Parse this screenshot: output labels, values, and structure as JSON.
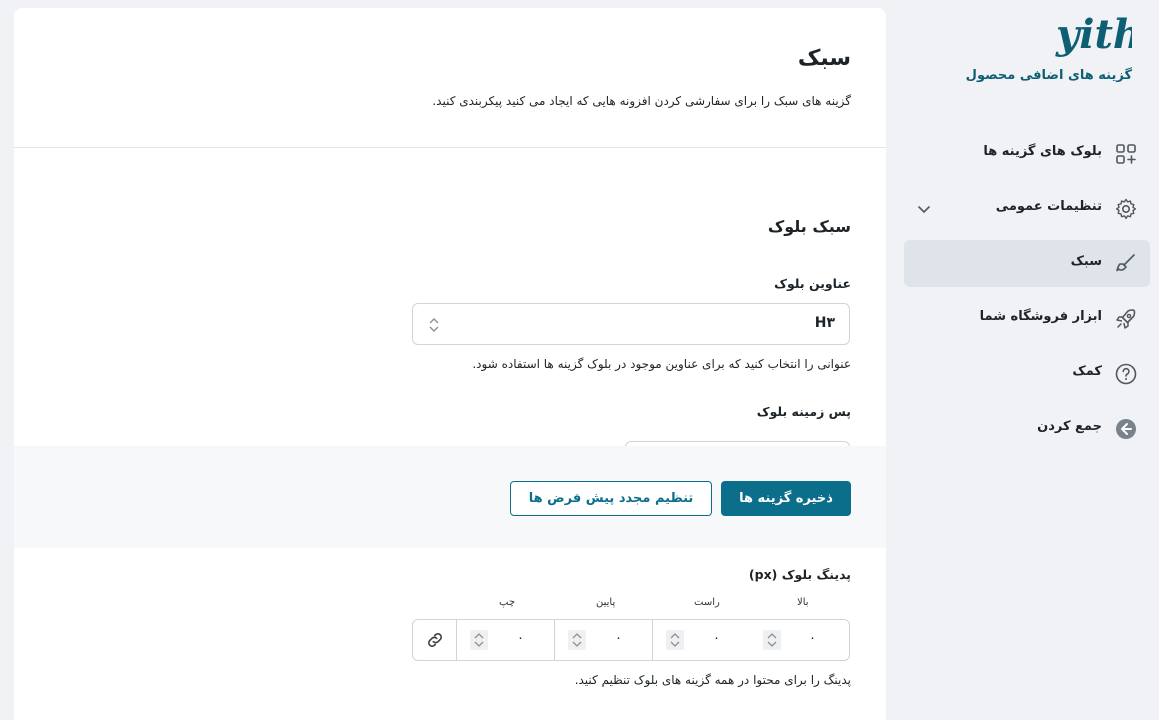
{
  "sidebar": {
    "logo_text": "yith",
    "brand_title": "گزینه های اضافی محصول",
    "items": [
      {
        "label": "بلوک های گزینه ها",
        "icon": "blocks-icon",
        "active": false
      },
      {
        "label": "تنظیمات عمومی",
        "icon": "gear-icon",
        "active": false,
        "expandable": true
      },
      {
        "label": "سبک",
        "icon": "brush-icon",
        "active": true
      },
      {
        "label": "ابزار فروشگاه شما",
        "icon": "rocket-icon",
        "active": false
      },
      {
        "label": "کمک",
        "icon": "help-icon",
        "active": false
      },
      {
        "label": "جمع کردن",
        "icon": "collapse-icon",
        "active": false
      }
    ]
  },
  "page": {
    "title": "سبک",
    "description": "گزینه های سبک را برای سفارشی کردن افزونه هایی که ایجاد می کنید پیکربندی کنید."
  },
  "section": {
    "title": "سبک بلوک"
  },
  "fields": {
    "block_titles": {
      "label": "عناوین بلوک",
      "value": "H۳",
      "help": "عنوانی را انتخاب کنید که برای عناوین موجود در بلوک گزینه ها استفاده شود."
    },
    "block_background": {
      "label": "پس زمینه بلوک"
    },
    "block_padding": {
      "label": "پدینگ بلوک (px)",
      "sides": [
        "بالا",
        "راست",
        "پایین",
        "چپ"
      ],
      "values": [
        "۰",
        "۰",
        "۰",
        "۰"
      ],
      "help": "پدینگ را برای محتوا در همه گزینه های بلوک تنظیم کنید."
    }
  },
  "actions": {
    "save_label": "ذخیره گزینه ها",
    "reset_label": "تنظیم مجدد پیش فرض ها"
  },
  "colors": {
    "brand": "#0b6f8c",
    "logo": "#0f5f74",
    "active_nav_bg": "#dfe3ea",
    "page_bg": "#f0f2f5"
  }
}
